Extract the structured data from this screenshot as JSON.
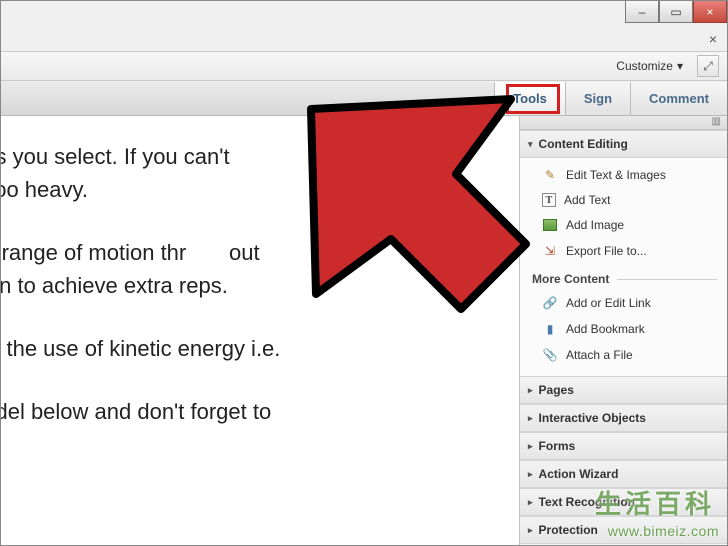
{
  "titlebar": {
    "minimize": "–",
    "maximize": "▭",
    "close": "×"
  },
  "secondary_close": "×",
  "customize": {
    "label": "Customize",
    "caret": "▾",
    "expand_glyph": "⤢"
  },
  "tabs": {
    "tools": "Tools",
    "sign": "Sign",
    "comment": "Comment"
  },
  "panel_strip_glyph": "▥",
  "sections": {
    "content_editing": {
      "title": "Content Editing",
      "caret": "▾",
      "items": {
        "edit_text_images": "Edit Text & Images",
        "add_text": "Add Text",
        "add_image": "Add Image",
        "export_file": "Export File to..."
      },
      "more": {
        "title": "More Content",
        "items": {
          "add_edit_link": "Add or Edit Link",
          "add_bookmark": "Add Bookmark",
          "attach_file": "Attach a File"
        }
      }
    },
    "pages": {
      "title": "Pages",
      "caret": "▸"
    },
    "interactive_objects": {
      "title": "Interactive Objects",
      "caret": "▸"
    },
    "forms": {
      "title": "Forms",
      "caret": "▸"
    },
    "action_wizard": {
      "title": "Action Wizard",
      "caret": "▸"
    },
    "recognition": {
      "title": "Text Recognition",
      "caret": "▸"
    },
    "protection": {
      "title": "Protection",
      "caret": "▸"
    }
  },
  "document": {
    "p1": "ads you select. If you can't\ns too heavy.",
    "p2": "ed range of motion thr       out\nition to achieve extra reps.",
    "p3": "oid the use of kinetic energy i.e.",
    "p4": "nodel below and don't forget to"
  },
  "watermark": {
    "cn": "生活百科",
    "url": "www.bimeiz.com"
  }
}
